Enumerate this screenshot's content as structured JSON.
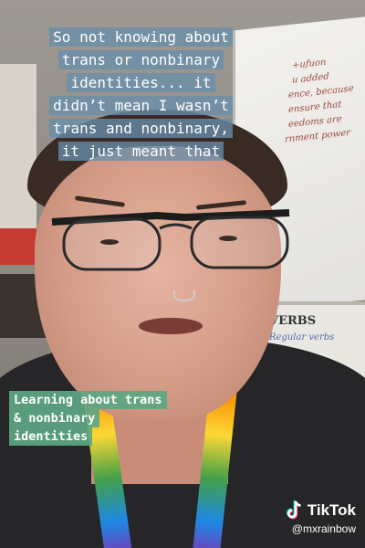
{
  "captions": {
    "top_lines": [
      "So not knowing about",
      "trans or nonbinary",
      "identities... it",
      "didn’t mean I wasn’t",
      "trans and nonbinary,",
      "it just meant that"
    ],
    "green_lines": [
      "Learning about trans",
      "& nonbinary",
      "identities"
    ]
  },
  "watermark": {
    "brand": "TikTok",
    "handle": "@mxrainbow",
    "icon": "tiktok-logo-icon"
  },
  "background_text": {
    "board_1": "+ufuon",
    "board_2": "u added",
    "board_3": "ence, because",
    "board_4": "ensure that",
    "board_5": "eedoms are",
    "board_6": "rnment power",
    "board_7": "VERBS",
    "board_8": "Regular verbs"
  },
  "colors": {
    "caption_top_bg": "#688eaa",
    "caption_green_bg": "#5ca682",
    "text": "#ffffff"
  }
}
